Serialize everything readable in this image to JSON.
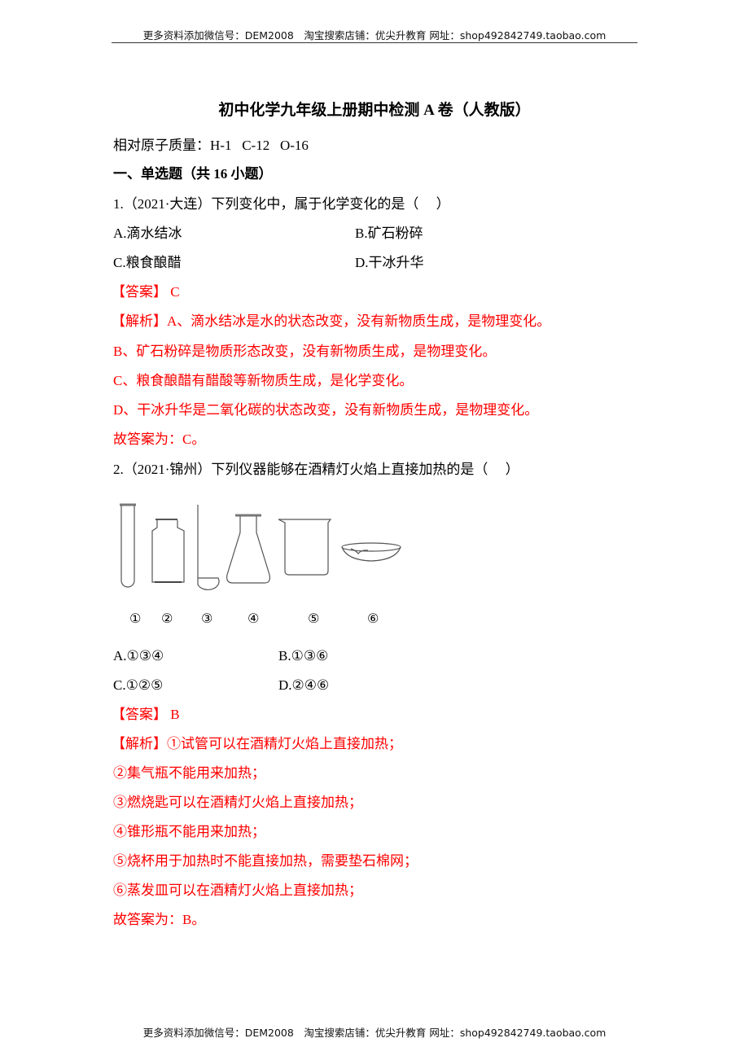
{
  "header": {
    "text": "更多资料添加微信号：DEM2008　淘宝搜索店铺：优尖升教育 网址：shop492842749.taobao.com"
  },
  "footer": {
    "text": "更多资料添加微信号：DEM2008　淘宝搜索店铺：优尖升教育 网址：shop492842749.taobao.com"
  },
  "document": {
    "title": "初中化学九年级上册期中检测 A 卷（人教版）",
    "atomic_masses_label": "相对原子质量：",
    "atomic_masses": "H-1   C-12   O-16",
    "section_heading": "一、单选题（共 16 小题）"
  },
  "questions": [
    {
      "stem": "1.（2021·大连）下列变化中，属于化学变化的是（　 ）",
      "options": [
        "A.滴水结冰",
        "B.矿石粉碎",
        "C.粮食酿醋",
        "D.干冰升华"
      ],
      "answer_label": "【答案】",
      "answer": "C",
      "analysis_label": "【解析】",
      "analysis": [
        "A、滴水结冰是水的状态改变，没有新物质生成，是物理变化。",
        "B、矿石粉碎是物质形态改变，没有新物质生成，是物理变化。",
        "C、粮食酿醋有醋酸等新物质生成，是化学变化。",
        "D、干冰升华是二氧化碳的状态改变，没有新物质生成，是物理变化。",
        "故答案为：C。"
      ]
    },
    {
      "stem": "2.（2021·锦州）下列仪器能够在酒精灯火焰上直接加热的是（　 ）",
      "apparatus": [
        {
          "number": "①",
          "icon": "test-tube-icon"
        },
        {
          "number": "②",
          "icon": "gas-jar-icon"
        },
        {
          "number": "③",
          "icon": "combustion-spoon-icon"
        },
        {
          "number": "④",
          "icon": "erlenmeyer-flask-icon"
        },
        {
          "number": "⑤",
          "icon": "beaker-icon"
        },
        {
          "number": "⑥",
          "icon": "evaporating-dish-icon"
        }
      ],
      "options": [
        "A.①③④",
        "B.①③⑥",
        "C.①②⑤",
        "D.②④⑥"
      ],
      "answer_label": "【答案】",
      "answer": "B",
      "analysis_label": "【解析】",
      "analysis": [
        "①试管可以在酒精灯火焰上直接加热；",
        "②集气瓶不能用来加热；",
        "③燃烧匙可以在酒精灯火焰上直接加热；",
        "④锥形瓶不能用来加热；",
        "⑤烧杯用于加热时不能直接加热，需要垫石棉网；",
        "⑥蒸发皿可以在酒精灯火焰上直接加热；",
        "故答案为：B。"
      ]
    }
  ],
  "colors": {
    "answer_red": "#ff0000",
    "text": "#000000"
  }
}
